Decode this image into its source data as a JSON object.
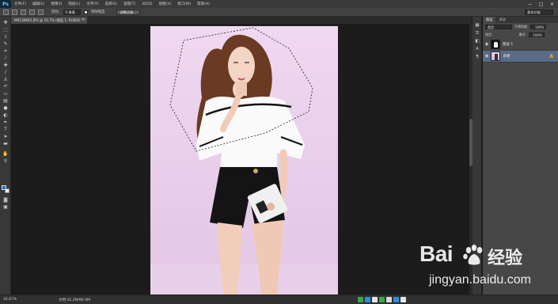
{
  "app": {
    "logo": "Ps"
  },
  "menu": [
    "文件(F)",
    "编辑(E)",
    "图像(I)",
    "图层(L)",
    "文字(Y)",
    "选择(S)",
    "滤镜(T)",
    "3D(D)",
    "视图(V)",
    "窗口(W)",
    "帮助(H)"
  ],
  "window_controls": {
    "minimize": "—",
    "maximize": "□",
    "close": "✕"
  },
  "options_bar": {
    "feather_label": "羽化:",
    "feather_value": "0 像素",
    "antialias_label": "消除锯齿",
    "refine_button": "调整边缘...",
    "workspace": "基本功能"
  },
  "document_tab": {
    "title": "M0130845.JPG @ 16.7% (图层 1, RGB/8) *",
    "close": "×"
  },
  "status_bar": {
    "zoom": "16.67%",
    "doc_info": "文档:42.2M/96.9M"
  },
  "panels": {
    "tabs": [
      "图层",
      "通道"
    ],
    "kind_select": "类型",
    "opacity_label": "不透明度:",
    "opacity_value": "100%",
    "lock_label": "锁定:",
    "fill_label": "填充:",
    "fill_value": "100%",
    "layers": [
      {
        "name": "图层 1",
        "type": "mask",
        "selected": false,
        "visible": true
      },
      {
        "name": "背景",
        "type": "photo",
        "selected": true,
        "visible": true,
        "locked": true
      }
    ]
  },
  "watermark": {
    "brand": "Bai",
    "brand_suffix": "经验",
    "url": "jingyan.baidu.com"
  },
  "colors": {
    "foreground": "#1d6fc4",
    "background": "#ffffff",
    "canvas_bg": "#ecd3ee"
  },
  "icons": [
    "move-icon",
    "marquee-icon",
    "lasso-icon",
    "quick-select-icon",
    "crop-icon",
    "eyedropper-icon",
    "healing-icon",
    "brush-icon",
    "clone-stamp-icon",
    "history-brush-icon",
    "eraser-icon",
    "gradient-icon",
    "blur-icon",
    "dodge-icon",
    "pen-icon",
    "type-icon",
    "path-select-icon",
    "shape-icon",
    "hand-icon",
    "zoom-icon"
  ]
}
